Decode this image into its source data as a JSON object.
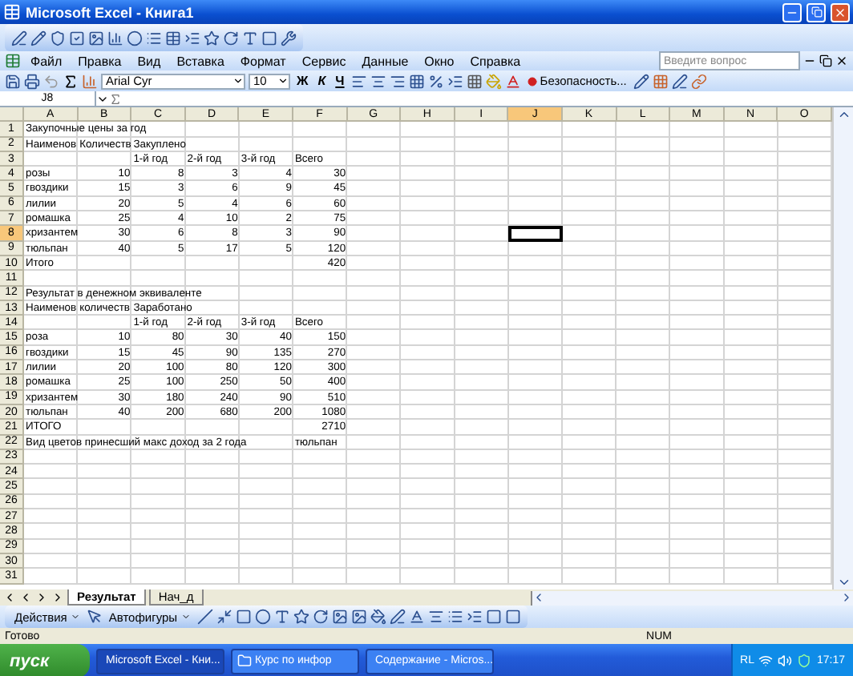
{
  "window": {
    "title": "Microsoft Excel - Книга1"
  },
  "menu": [
    {
      "label": "Файл"
    },
    {
      "label": "Правка"
    },
    {
      "label": "Вид"
    },
    {
      "label": "Вставка"
    },
    {
      "label": "Формат"
    },
    {
      "label": "Сервис"
    },
    {
      "label": "Данные"
    },
    {
      "label": "Окно"
    },
    {
      "label": "Справка"
    }
  ],
  "help_search": {
    "placeholder": "Введите вопрос"
  },
  "formatting": {
    "font": "Arial Cyr",
    "size": "10",
    "bold": "Ж",
    "italic": "К",
    "underline": "Ч",
    "security": "Безопасность..."
  },
  "formula_bar": {
    "name_box": "J8"
  },
  "columns": [
    {
      "label": "A",
      "selected": false
    },
    {
      "label": "B",
      "selected": false
    },
    {
      "label": "C",
      "selected": false
    },
    {
      "label": "D",
      "selected": false
    },
    {
      "label": "E",
      "selected": false
    },
    {
      "label": "F",
      "selected": false
    },
    {
      "label": "G",
      "selected": false
    },
    {
      "label": "H",
      "selected": false
    },
    {
      "label": "I",
      "selected": false
    },
    {
      "label": "J",
      "selected": true
    },
    {
      "label": "K",
      "selected": false
    },
    {
      "label": "L",
      "selected": false
    },
    {
      "label": "M",
      "selected": false
    },
    {
      "label": "N",
      "selected": false
    },
    {
      "label": "O",
      "selected": false
    }
  ],
  "rows": [
    {
      "label": "1",
      "selected": false,
      "cells": {
        "A": {
          "kind": "text",
          "text": "Закупочные цены за год"
        }
      }
    },
    {
      "label": "2",
      "selected": false,
      "cells": {
        "A": {
          "kind": "text",
          "text": "Наименов"
        },
        "B": {
          "kind": "text",
          "text": "Количеств"
        },
        "C": {
          "kind": "text",
          "text": "Закуплено"
        }
      }
    },
    {
      "label": "3",
      "selected": false,
      "cells": {
        "C": {
          "kind": "text",
          "text": "1-й год"
        },
        "D": {
          "kind": "text",
          "text": "2-й год"
        },
        "E": {
          "kind": "text",
          "text": "3-й год"
        },
        "F": {
          "kind": "text",
          "text": "Всего"
        }
      }
    },
    {
      "label": "4",
      "selected": false,
      "cells": {
        "A": {
          "kind": "text",
          "text": "розы"
        },
        "B": {
          "kind": "number",
          "text": "10"
        },
        "C": {
          "kind": "number",
          "text": "8"
        },
        "D": {
          "kind": "number",
          "text": "3"
        },
        "E": {
          "kind": "number",
          "text": "4"
        },
        "F": {
          "kind": "number",
          "text": "30"
        }
      }
    },
    {
      "label": "5",
      "selected": false,
      "cells": {
        "A": {
          "kind": "text",
          "text": "гвоздики"
        },
        "B": {
          "kind": "number",
          "text": "15"
        },
        "C": {
          "kind": "number",
          "text": "3"
        },
        "D": {
          "kind": "number",
          "text": "6"
        },
        "E": {
          "kind": "number",
          "text": "9"
        },
        "F": {
          "kind": "number",
          "text": "45"
        }
      }
    },
    {
      "label": "6",
      "selected": false,
      "cells": {
        "A": {
          "kind": "text",
          "text": "лилии"
        },
        "B": {
          "kind": "number",
          "text": "20"
        },
        "C": {
          "kind": "number",
          "text": "5"
        },
        "D": {
          "kind": "number",
          "text": "4"
        },
        "E": {
          "kind": "number",
          "text": "6"
        },
        "F": {
          "kind": "number",
          "text": "60"
        }
      }
    },
    {
      "label": "7",
      "selected": false,
      "cells": {
        "A": {
          "kind": "text",
          "text": "ромашка"
        },
        "B": {
          "kind": "number",
          "text": "25"
        },
        "C": {
          "kind": "number",
          "text": "4"
        },
        "D": {
          "kind": "number",
          "text": "10"
        },
        "E": {
          "kind": "number",
          "text": "2"
        },
        "F": {
          "kind": "number",
          "text": "75"
        }
      }
    },
    {
      "label": "8",
      "selected": true,
      "cells": {
        "A": {
          "kind": "text",
          "text": "хризантем"
        },
        "B": {
          "kind": "number",
          "text": "30"
        },
        "C": {
          "kind": "number",
          "text": "6"
        },
        "D": {
          "kind": "number",
          "text": "8"
        },
        "E": {
          "kind": "number",
          "text": "3"
        },
        "F": {
          "kind": "number",
          "text": "90"
        }
      }
    },
    {
      "label": "9",
      "selected": false,
      "cells": {
        "A": {
          "kind": "text",
          "text": "тюльпан"
        },
        "B": {
          "kind": "number",
          "text": "40"
        },
        "C": {
          "kind": "number",
          "text": "5"
        },
        "D": {
          "kind": "number",
          "text": "17"
        },
        "E": {
          "kind": "number",
          "text": "5"
        },
        "F": {
          "kind": "number",
          "text": "120"
        }
      }
    },
    {
      "label": "10",
      "selected": false,
      "cells": {
        "A": {
          "kind": "text",
          "text": "Итого"
        },
        "F": {
          "kind": "number",
          "text": "420"
        }
      }
    },
    {
      "label": "11",
      "selected": false,
      "cells": {}
    },
    {
      "label": "12",
      "selected": false,
      "cells": {
        "A": {
          "kind": "text",
          "text": "Результат в денежном эквиваленте"
        }
      }
    },
    {
      "label": "13",
      "selected": false,
      "cells": {
        "A": {
          "kind": "text",
          "text": "Наименов"
        },
        "B": {
          "kind": "text",
          "text": "количеств"
        },
        "C": {
          "kind": "text",
          "text": "Заработано"
        }
      }
    },
    {
      "label": "14",
      "selected": false,
      "cells": {
        "C": {
          "kind": "text",
          "text": "1-й год"
        },
        "D": {
          "kind": "text",
          "text": "2-й год"
        },
        "E": {
          "kind": "text",
          "text": "3-й год"
        },
        "F": {
          "kind": "text",
          "text": "Всего"
        }
      }
    },
    {
      "label": "15",
      "selected": false,
      "cells": {
        "A": {
          "kind": "text",
          "text": "роза"
        },
        "B": {
          "kind": "number",
          "text": "10"
        },
        "C": {
          "kind": "number",
          "text": "80"
        },
        "D": {
          "kind": "number",
          "text": "30"
        },
        "E": {
          "kind": "number",
          "text": "40"
        },
        "F": {
          "kind": "number",
          "text": "150"
        }
      }
    },
    {
      "label": "16",
      "selected": false,
      "cells": {
        "A": {
          "kind": "text",
          "text": "гвоздики"
        },
        "B": {
          "kind": "number",
          "text": "15"
        },
        "C": {
          "kind": "number",
          "text": "45"
        },
        "D": {
          "kind": "number",
          "text": "90"
        },
        "E": {
          "kind": "number",
          "text": "135"
        },
        "F": {
          "kind": "number",
          "text": "270"
        }
      }
    },
    {
      "label": "17",
      "selected": false,
      "cells": {
        "A": {
          "kind": "text",
          "text": "лилии"
        },
        "B": {
          "kind": "number",
          "text": "20"
        },
        "C": {
          "kind": "number",
          "text": "100"
        },
        "D": {
          "kind": "number",
          "text": "80"
        },
        "E": {
          "kind": "number",
          "text": "120"
        },
        "F": {
          "kind": "number",
          "text": "300"
        }
      }
    },
    {
      "label": "18",
      "selected": false,
      "cells": {
        "A": {
          "kind": "text",
          "text": "ромашка"
        },
        "B": {
          "kind": "number",
          "text": "25"
        },
        "C": {
          "kind": "number",
          "text": "100"
        },
        "D": {
          "kind": "number",
          "text": "250"
        },
        "E": {
          "kind": "number",
          "text": "50"
        },
        "F": {
          "kind": "number",
          "text": "400"
        }
      }
    },
    {
      "label": "19",
      "selected": false,
      "cells": {
        "A": {
          "kind": "text",
          "text": "хризантем"
        },
        "B": {
          "kind": "number",
          "text": "30"
        },
        "C": {
          "kind": "number",
          "text": "180"
        },
        "D": {
          "kind": "number",
          "text": "240"
        },
        "E": {
          "kind": "number",
          "text": "90"
        },
        "F": {
          "kind": "number",
          "text": "510"
        }
      }
    },
    {
      "label": "20",
      "selected": false,
      "cells": {
        "A": {
          "kind": "text",
          "text": "тюльпан"
        },
        "B": {
          "kind": "number",
          "text": "40"
        },
        "C": {
          "kind": "number",
          "text": "200"
        },
        "D": {
          "kind": "number",
          "text": "680"
        },
        "E": {
          "kind": "number",
          "text": "200"
        },
        "F": {
          "kind": "number",
          "text": "1080"
        }
      }
    },
    {
      "label": "21",
      "selected": false,
      "cells": {
        "A": {
          "kind": "text",
          "text": "ИТОГО"
        },
        "F": {
          "kind": "number",
          "text": "2710"
        }
      }
    },
    {
      "label": "22",
      "selected": false,
      "cells": {
        "A": {
          "kind": "text",
          "text": "Вид цветов принесший макс доход за 2 года"
        },
        "F": {
          "kind": "text",
          "text": "тюльпан"
        }
      }
    },
    {
      "label": "23",
      "selected": false,
      "cells": {}
    },
    {
      "label": "24",
      "selected": false,
      "cells": {}
    },
    {
      "label": "25",
      "selected": false,
      "cells": {}
    },
    {
      "label": "26",
      "selected": false,
      "cells": {}
    },
    {
      "label": "27",
      "selected": false,
      "cells": {}
    },
    {
      "label": "28",
      "selected": false,
      "cells": {}
    },
    {
      "label": "29",
      "selected": false,
      "cells": {}
    },
    {
      "label": "30",
      "selected": false,
      "cells": {}
    },
    {
      "label": "31",
      "selected": false,
      "cells": {}
    }
  ],
  "sheet_tabs": [
    {
      "label": "Результат",
      "selected": true
    },
    {
      "label": "Нач_д",
      "selected": false
    }
  ],
  "drawing_toolbar": {
    "actions": "Действия",
    "autoshapes": "Автофигуры"
  },
  "status_bar": {
    "status": "Готово",
    "num": "NUM"
  },
  "taskbar": {
    "start": "пуск",
    "tasks": [
      {
        "label": "Microsoft Excel - Кни...",
        "kind": "sheet",
        "selected": true
      },
      {
        "label": "Курс по инфор",
        "kind": "folder",
        "selected": false
      },
      {
        "label": "Содержание - Micros...",
        "kind": "document",
        "selected": false
      }
    ],
    "language": "RL",
    "clock": "17:17"
  }
}
